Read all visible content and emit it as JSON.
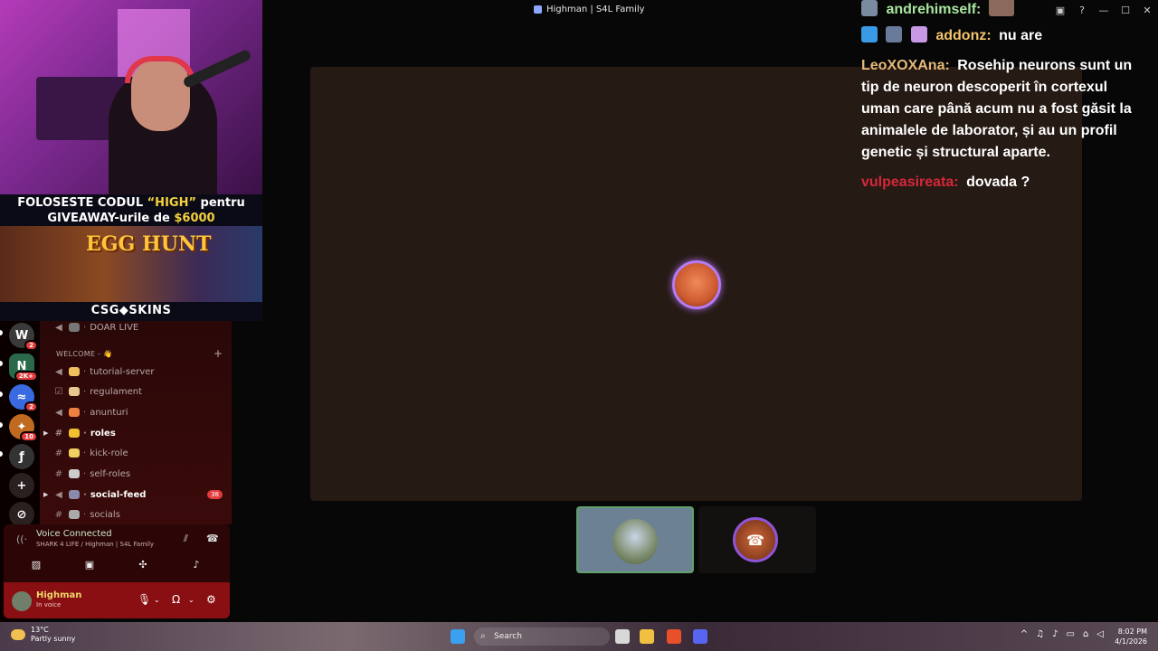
{
  "window": {
    "title": "Highman | S4L Family"
  },
  "promo": {
    "line1_pre": "FOLOSESTE CODUL ",
    "line1_code": "“HIGH”",
    "line1_post": " pentru",
    "line2_pre": "GIVEAWAY-urile de ",
    "line2_amount": "$6000",
    "banner": "EGG HUNT",
    "brand": "CSG◆SKINS"
  },
  "servers": [
    {
      "label": "W",
      "badge": "2",
      "color": "#3a3a3a"
    },
    {
      "label": "N",
      "badge": "2K+",
      "color": "#2a6a4a"
    },
    {
      "label": "≈",
      "badge": "2",
      "color": "#3a6ae0"
    },
    {
      "label": "✦",
      "badge": "10",
      "color": "#c06a20"
    },
    {
      "label": "ƒ",
      "badge": "",
      "color": "#333333"
    }
  ],
  "channels": {
    "top": "DOAR LIVE",
    "category": "WELCOME - 👋",
    "items": [
      {
        "name": "tutorial-server",
        "type": "announce",
        "bold": false
      },
      {
        "name": "regulament",
        "type": "rules",
        "bold": false
      },
      {
        "name": "anunturi",
        "type": "announce",
        "bold": false
      },
      {
        "name": "roles",
        "type": "text",
        "bold": true
      },
      {
        "name": "kick-role",
        "type": "text",
        "bold": false
      },
      {
        "name": "self-roles",
        "type": "text",
        "bold": false
      },
      {
        "name": "social-feed",
        "type": "announce",
        "bold": true,
        "count": "38"
      },
      {
        "name": "socials",
        "type": "text",
        "bold": false
      }
    ]
  },
  "voice": {
    "status": "Voice Connected",
    "location": "SHARK 4 LIFE / Highman | S4L Family"
  },
  "user": {
    "name": "Highman",
    "status": "In voice"
  },
  "chat": [
    {
      "user": "andrehimself:",
      "text": "",
      "color": "#a8e6a0"
    },
    {
      "user": "addonz:",
      "text": "nu are",
      "color": "#f2c46a"
    },
    {
      "user": "LeoXOXAna:",
      "text": "Rosehip neurons sunt un tip de neuron descoperit în cortexul uman care până acum nu a fost găsit la animalele de laborator, și au un profil genetic și structural aparte.",
      "color": "#e6b878"
    },
    {
      "user": "vulpeasireata:",
      "text": "dovada ?",
      "color": "#d6283a"
    }
  ],
  "taskbar": {
    "temp": "13°C",
    "weather": "Partly sunny",
    "search_placeholder": "Search",
    "time": "8:02 PM",
    "date": "4/1/2026"
  }
}
